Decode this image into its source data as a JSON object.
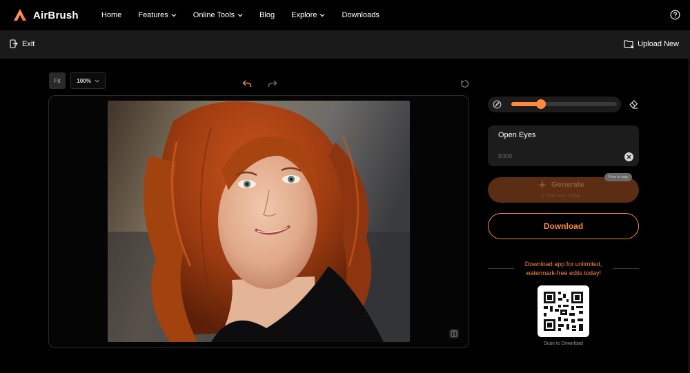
{
  "brand": {
    "name": "AirBrush",
    "accent": "#ff8a3d"
  },
  "nav": {
    "items": [
      {
        "label": "Home",
        "has_menu": false
      },
      {
        "label": "Features",
        "has_menu": true
      },
      {
        "label": "Online Tools",
        "has_menu": true
      },
      {
        "label": "Blog",
        "has_menu": false
      },
      {
        "label": "Explore",
        "has_menu": true
      },
      {
        "label": "Downloads",
        "has_menu": false
      }
    ],
    "help_icon": "help-icon"
  },
  "toolbar": {
    "exit_label": "Exit",
    "upload_label": "Upload New"
  },
  "editor": {
    "fit_label": "Fit",
    "zoom_value": "100%",
    "undo_icon": "undo-icon",
    "redo_icon": "redo-icon",
    "reset_icon": "reset-icon",
    "compare_icon": "compare-icon"
  },
  "panel": {
    "brush_size_fraction": 0.28,
    "prompt_text": "Open Eyes",
    "prompt_count": "9/300",
    "generate_label": "Generate",
    "generate_sub": "1 Free Gen Today",
    "generate_badge": "Free in app",
    "download_label": "Download",
    "promo_text": "Download app for unlimited, watermark-free edits today!",
    "scan_label": "Scan to Download"
  }
}
